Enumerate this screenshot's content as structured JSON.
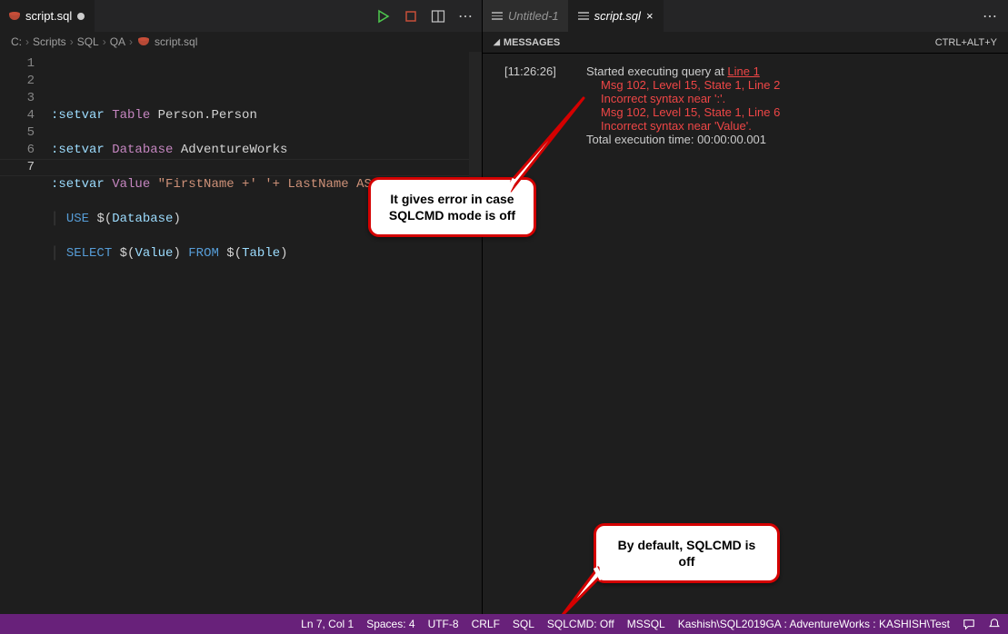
{
  "left": {
    "tab_label": "script.sql",
    "breadcrumb": [
      "C:",
      "Scripts",
      "SQL",
      "QA",
      "script.sql"
    ],
    "code": {
      "line2": {
        "cmd": ":setvar",
        "var": "Table",
        "rest": "Person.Person"
      },
      "line3": {
        "cmd": ":setvar",
        "var": "Database",
        "rest": "AdventureWorks"
      },
      "line4": {
        "cmd": ":setvar",
        "var": "Value",
        "str": "\"FirstName +' '+ LastName AS Name\""
      },
      "line5": {
        "kw": "USE",
        "id": "Database"
      },
      "line6": {
        "kw1": "SELECT",
        "id1": "Value",
        "kw2": "FROM",
        "id2": "Table"
      }
    }
  },
  "right": {
    "tab_inactive": "Untitled-1",
    "tab_active": "script.sql",
    "messages_label": "MESSAGES",
    "shortcut": "CTRL+ALT+Y",
    "time": "[11:26:26]",
    "m1": "Started executing query at ",
    "m1_link": "Line 1",
    "err1": "Msg 102, Level 15, State 1, Line 2",
    "err2": "Incorrect syntax near ':'.",
    "err3": "Msg 102, Level 15, State 1, Line 6",
    "err4": "Incorrect syntax near 'Value'.",
    "total": "Total execution time: 00:00:00.001"
  },
  "callout1": "It gives error in case SQLCMD mode is off",
  "callout2": "By default, SQLCMD is off",
  "status": {
    "ln": "Ln 7, Col 1",
    "spaces": "Spaces: 4",
    "enc": "UTF-8",
    "eol": "CRLF",
    "lang": "SQL",
    "sqlcmd": "SQLCMD: Off",
    "mssql": "MSSQL",
    "conn": "Kashish\\SQL2019GA : AdventureWorks : KASHISH\\Test"
  }
}
